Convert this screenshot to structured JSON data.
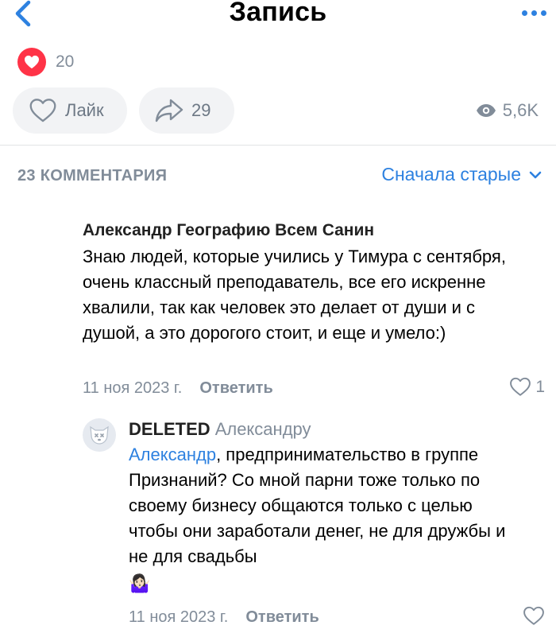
{
  "header": {
    "title": "Запись",
    "back_icon": "chevron-left-icon",
    "more_icon": "more-horizontal-icon"
  },
  "post": {
    "reactions": {
      "count": "20",
      "icon": "heart-icon"
    },
    "like_label": "Лайк",
    "share_count": "29",
    "views": "5,6K"
  },
  "comments": {
    "count_label": "23 КОММЕНТАРИЯ",
    "sort_label": "Сначала старые",
    "items": [
      {
        "author": "Александр Географию Всем Санин",
        "text": "Знаю людей, которые учились у Тимура с сентября, очень классный преподаватель, все его искренне хвалили, так как человек это делает от души и с душой, а это дорогого стоит, и еще и умело:)",
        "date": "11 ноя 2023 г.",
        "reply_label": "Ответить",
        "likes": "1"
      },
      {
        "author": "DELETED",
        "reply_to": "Александру",
        "mention": "Александр",
        "text": ", предпринимательство в группе Признаний? Со мной парни тоже только по своему бизнесу общаются только с целью чтобы они заработали денег, не для дружбы и не для свадьбы",
        "emoji": "🤷🏻‍♀️",
        "date": "11 ноя 2023 г.",
        "reply_label": "Ответить"
      }
    ]
  },
  "colors": {
    "accent": "#2d81e0",
    "secondary_text": "#818c99",
    "reaction_red": "#ff3347",
    "pill_bg": "#f2f3f5"
  }
}
